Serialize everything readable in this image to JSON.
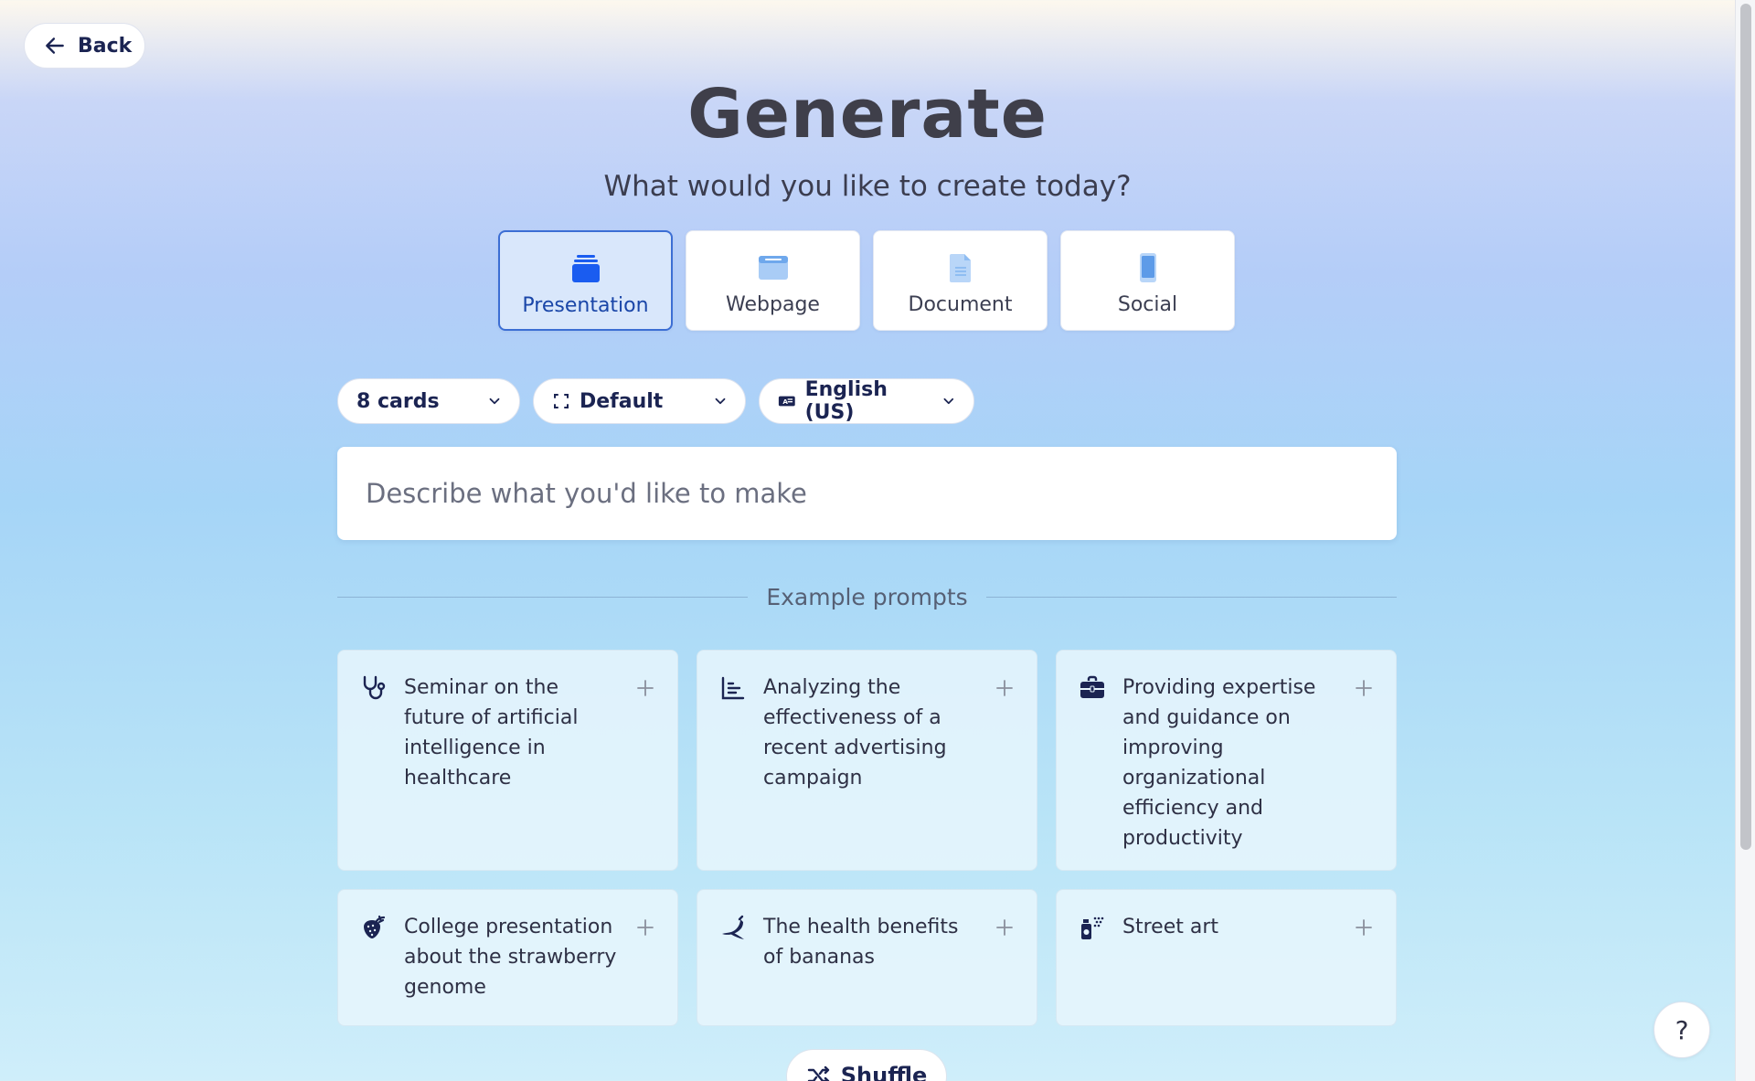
{
  "back": {
    "label": "Back"
  },
  "header": {
    "title": "Generate",
    "subtitle": "What would you like to create today?"
  },
  "types": [
    {
      "label": "Presentation",
      "icon": "presentation-icon",
      "active": true
    },
    {
      "label": "Webpage",
      "icon": "webpage-icon",
      "active": false
    },
    {
      "label": "Document",
      "icon": "document-icon",
      "active": false
    },
    {
      "label": "Social",
      "icon": "social-icon",
      "active": false
    }
  ],
  "controls": {
    "cards": "8 cards",
    "format": "Default",
    "language": "English (US)"
  },
  "prompt": {
    "placeholder": "Describe what you'd like to make"
  },
  "examples": {
    "heading": "Example prompts",
    "items": [
      {
        "text": "Seminar on the future of artificial intelligence in healthcare",
        "icon": "stethoscope-icon"
      },
      {
        "text": "Analyzing the effectiveness of a recent advertising campaign",
        "icon": "bar-chart-icon"
      },
      {
        "text": "Providing expertise and guidance on improving organizational efficiency and productivity",
        "icon": "briefcase-icon"
      },
      {
        "text": "College presentation about the strawberry genome",
        "icon": "strawberry-icon"
      },
      {
        "text": "The health benefits of bananas",
        "icon": "banana-icon"
      },
      {
        "text": "Street art",
        "icon": "spray-can-icon"
      }
    ]
  },
  "shuffle": {
    "label": "Shuffle"
  },
  "help": {
    "label": "?"
  },
  "colors": {
    "accent": "#3c6ed4",
    "icon_navy": "#1b2452",
    "icon_blue": "#1a5cf0"
  }
}
